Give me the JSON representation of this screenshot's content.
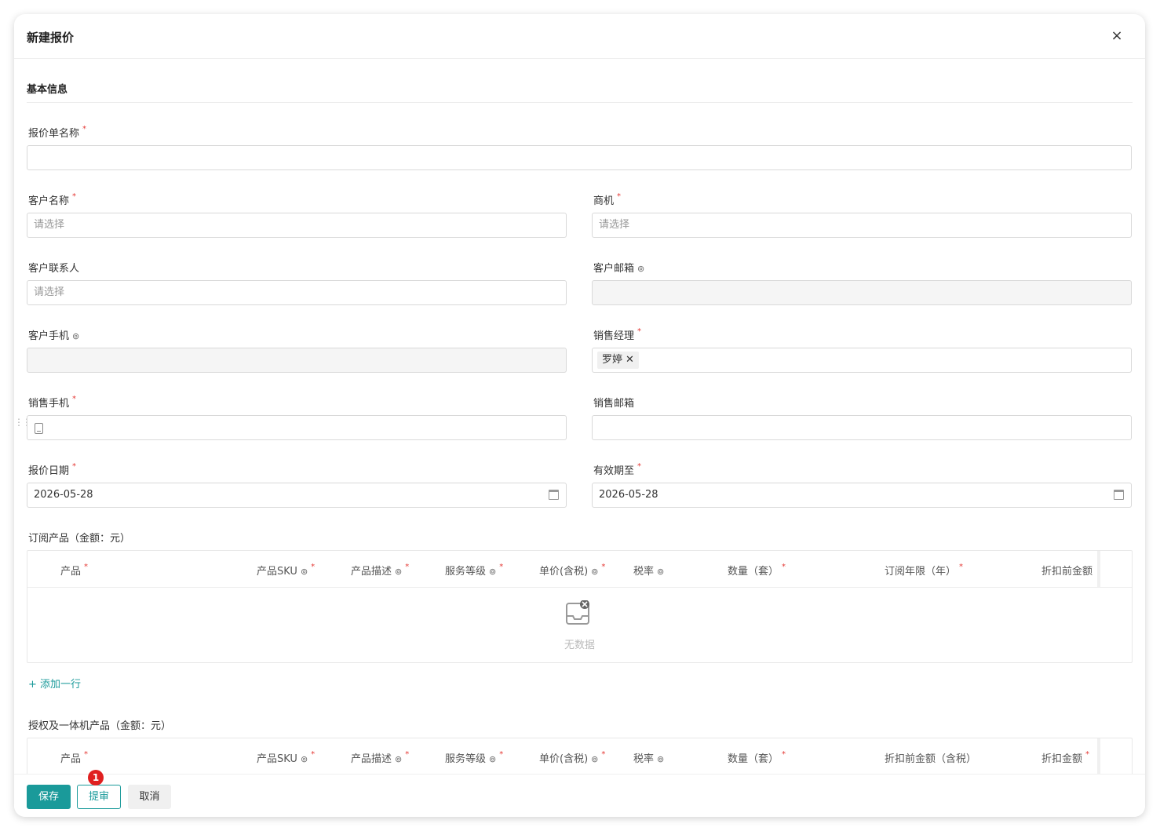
{
  "dialog": {
    "title": "新建报价",
    "close": "×"
  },
  "section": {
    "title": "基本信息"
  },
  "fields": {
    "quote_name": {
      "label": "报价单名称",
      "value": ""
    },
    "customer": {
      "label": "客户名称",
      "placeholder": "请选择"
    },
    "opportunity": {
      "label": "商机",
      "placeholder": "请选择"
    },
    "contact": {
      "label": "客户联系人",
      "placeholder": "请选择"
    },
    "customer_email": {
      "label": "客户邮箱",
      "value": ""
    },
    "customer_phone": {
      "label": "客户手机",
      "value": ""
    },
    "sales_manager": {
      "label": "销售经理",
      "tag": "罗婷",
      "tag_close": "✕"
    },
    "sales_phone": {
      "label": "销售手机",
      "value": ""
    },
    "sales_email": {
      "label": "销售邮箱",
      "value": ""
    },
    "quote_date": {
      "label": "报价日期",
      "value": "2026-05-28"
    },
    "valid_until": {
      "label": "有效期至",
      "value": "2026-05-28"
    }
  },
  "required_mark": "*",
  "eye_icon": "⊚",
  "subscription_table": {
    "title": "订阅产品（金额：元）",
    "columns": [
      "产品",
      "产品SKU",
      "产品描述",
      "服务等级",
      "单价(含税)",
      "税率",
      "数量（套）",
      "订阅年限（年）",
      "折扣前金额"
    ],
    "empty_text": "无数据"
  },
  "add_row": "+  添加一行",
  "license_table": {
    "title": "授权及一体机产品（金额：元）",
    "columns": [
      "产品",
      "产品SKU",
      "产品描述",
      "服务等级",
      "单价(含税)",
      "税率",
      "数量（套）",
      "折扣前金额（含税）",
      "折扣金额"
    ]
  },
  "footer": {
    "save": "保存",
    "submit": "提审",
    "cancel": "取消",
    "badge": "1"
  },
  "colors": {
    "accent": "#1a9a9a",
    "required": "#e53935",
    "badge": "#e02020"
  }
}
